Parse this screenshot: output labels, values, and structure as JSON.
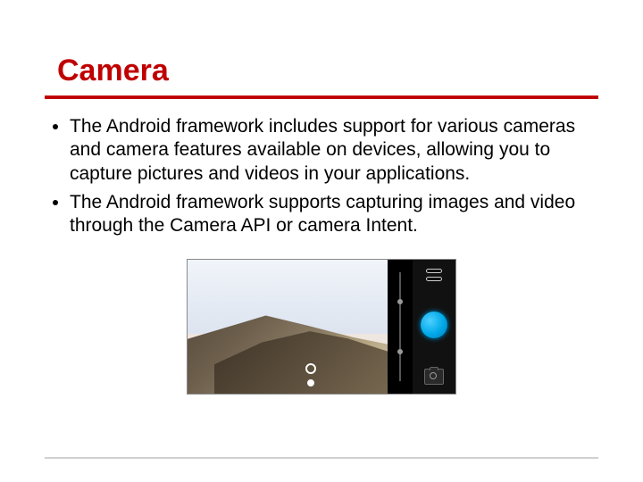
{
  "title": "Camera",
  "bullets": [
    "The Android framework includes support for various cameras and camera features available on devices, allowing you to capture pictures and videos in your applications.",
    "The Android framework supports capturing images and video through the Camera API or camera Intent."
  ],
  "colors": {
    "accent": "#c00000",
    "shutter": "#00a8e8"
  }
}
